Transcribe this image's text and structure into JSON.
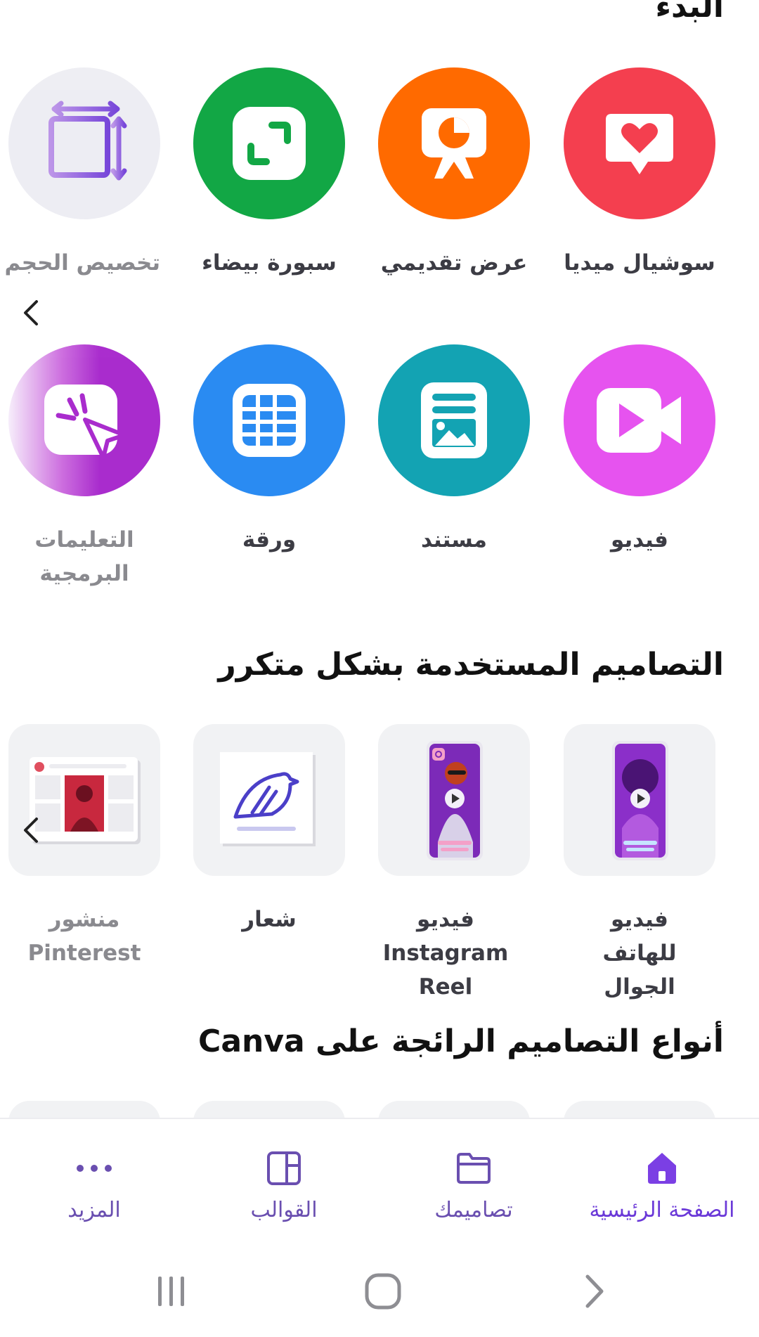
{
  "colors": {
    "social": "#f43f4f",
    "presentation": "#ff6a00",
    "whiteboard": "#12a745",
    "resize": "#ececf2",
    "video": "#e653ef",
    "document": "#13a3b3",
    "sheet": "#2a8bf2",
    "tutorial": "#a016c8",
    "accent": "#7b3fe4",
    "nav_text": "#6a4fb0"
  },
  "section_start": {
    "title": "البدء"
  },
  "start_row1": [
    {
      "label": "سوشيال ميديا",
      "icon": "speech-heart-icon"
    },
    {
      "label": "عرض تقديمي",
      "icon": "presentation-board-icon"
    },
    {
      "label": "سبورة بيضاء",
      "icon": "whiteboard-expand-icon"
    },
    {
      "label": "تخصيص الحجم",
      "icon": "resize-arrows-icon"
    }
  ],
  "start_row2": [
    {
      "label": "فيديو",
      "icon": "video-camera-icon"
    },
    {
      "label": "مستند",
      "icon": "document-image-icon"
    },
    {
      "label": "ورقة",
      "icon": "spreadsheet-grid-icon"
    },
    {
      "label": "التعليمات البرمجية",
      "icon": "click-cursor-icon"
    }
  ],
  "section_frequent": {
    "title": "التصاميم المستخدمة بشكل متكرر"
  },
  "frequent_items": [
    {
      "label": "فيديو للهاتف الجوال",
      "icon": "mobile-video-thumbnail"
    },
    {
      "label": "فيديو Instagram Reel",
      "icon": "instagram-reel-thumbnail"
    },
    {
      "label": "شعار",
      "icon": "bird-logo-thumbnail"
    },
    {
      "label": "منشور Pinterest",
      "icon": "pinterest-post-thumbnail"
    }
  ],
  "section_trending": {
    "title": "أنواع التصاميم الرائجة على Canva"
  },
  "bottom_nav": [
    {
      "label": "الصفحة الرئيسية",
      "icon": "home-icon",
      "active": true
    },
    {
      "label": "تصاميمك",
      "icon": "folder-icon",
      "active": false
    },
    {
      "label": "القوالب",
      "icon": "templates-icon",
      "active": false
    },
    {
      "label": "المزيد",
      "icon": "more-dots-icon",
      "active": false
    }
  ]
}
